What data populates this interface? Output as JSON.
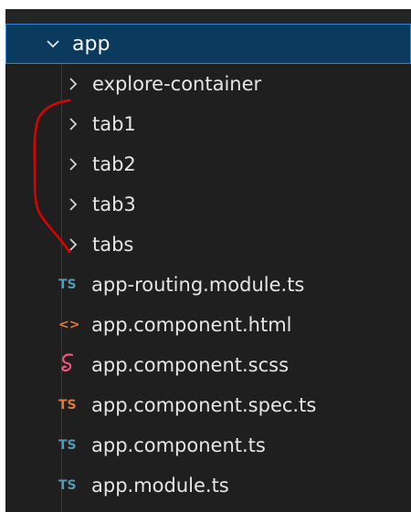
{
  "root_folder": {
    "label": "app",
    "icon": "chevron-down-icon"
  },
  "items": [
    {
      "label": "explore-container",
      "type": "folder",
      "icon": "chevron-right-icon"
    },
    {
      "label": "tab1",
      "type": "folder",
      "icon": "chevron-right-icon"
    },
    {
      "label": "tab2",
      "type": "folder",
      "icon": "chevron-right-icon"
    },
    {
      "label": "tab3",
      "type": "folder",
      "icon": "chevron-right-icon"
    },
    {
      "label": "tabs",
      "type": "folder",
      "icon": "chevron-right-icon"
    },
    {
      "label": "app-routing.module.ts",
      "type": "file",
      "icon_text": "TS",
      "icon_color": "#519aba"
    },
    {
      "label": "app.component.html",
      "type": "file",
      "icon_text": "<>",
      "icon_color": "#e37933"
    },
    {
      "label": "app.component.scss",
      "type": "file",
      "icon": "sass-icon",
      "icon_color": "#f55385"
    },
    {
      "label": "app.component.spec.ts",
      "type": "file",
      "icon_text": "TS",
      "icon_color": "#e37933"
    },
    {
      "label": "app.component.ts",
      "type": "file",
      "icon_text": "TS",
      "icon_color": "#519aba"
    },
    {
      "label": "app.module.ts",
      "type": "file",
      "icon_text": "TS",
      "icon_color": "#519aba"
    }
  ],
  "colors": {
    "sidebar_bg": "#1f1f1f",
    "selected_row_bg": "#0b3a5f",
    "selected_row_border": "#2f87d8",
    "annotation_stroke": "#e00000"
  }
}
